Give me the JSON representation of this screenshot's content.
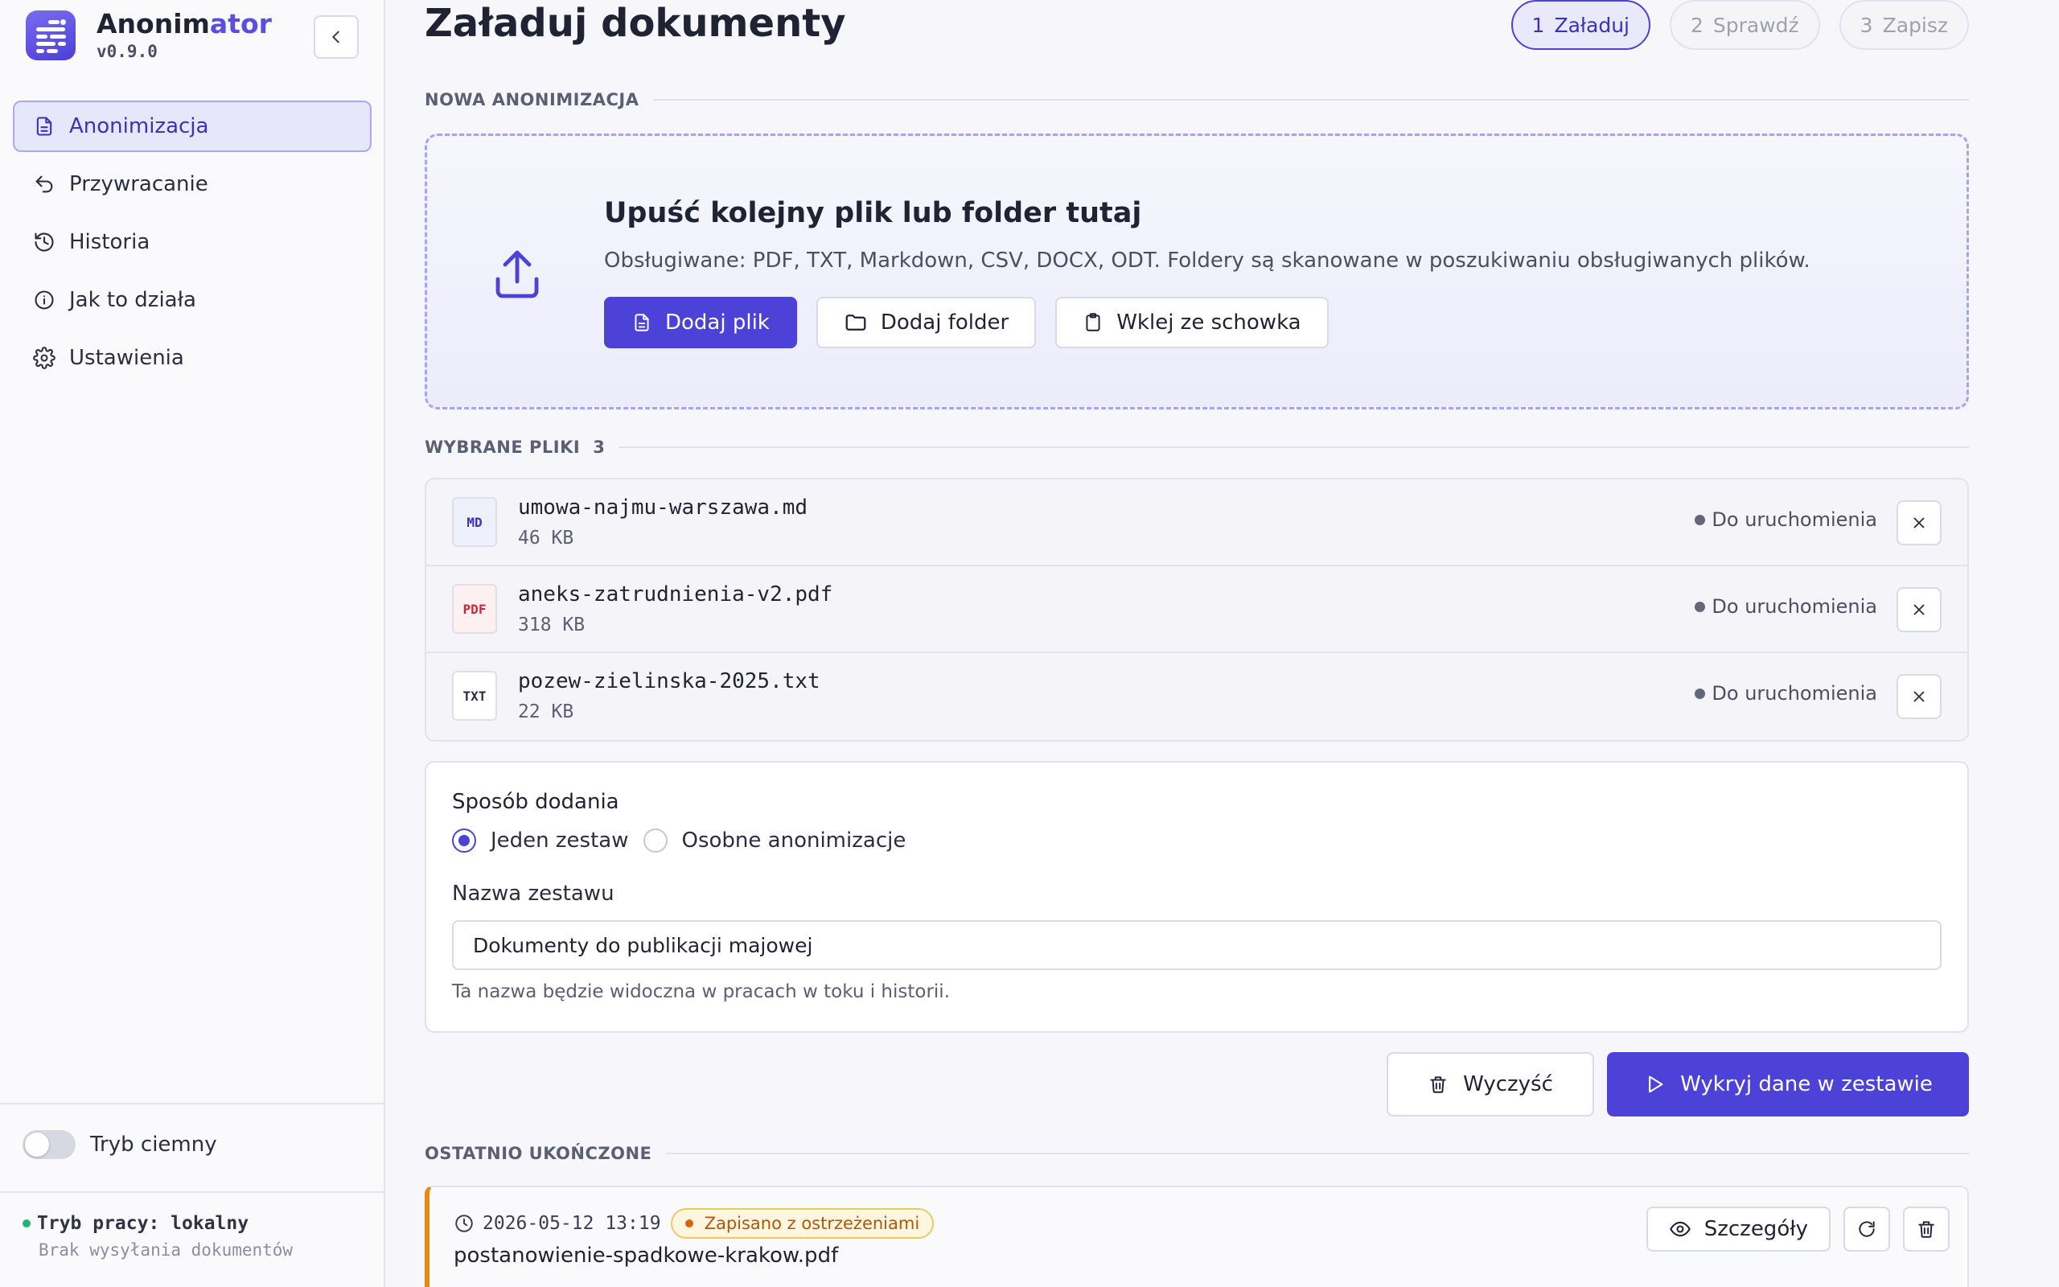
{
  "app": {
    "name_prefix": "Anonim",
    "name_accent": "ator",
    "version": "v0.9.0"
  },
  "sidebar": {
    "items": [
      {
        "label": "Anonimizacja",
        "icon": "document-icon",
        "active": true
      },
      {
        "label": "Przywracanie",
        "icon": "undo-icon"
      },
      {
        "label": "Historia",
        "icon": "history-icon"
      },
      {
        "label": "Jak to działa",
        "icon": "info-icon"
      },
      {
        "label": "Ustawienia",
        "icon": "gear-icon"
      }
    ],
    "theme_label": "Tryb ciemny",
    "theme_on": false,
    "mode_label": "Tryb pracy: lokalny",
    "mode_sub": "Brak wysyłania dokumentów"
  },
  "page": {
    "title": "Załaduj dokumenty"
  },
  "steps": [
    {
      "n": "1",
      "label": "Załaduj",
      "active": true
    },
    {
      "n": "2",
      "label": "Sprawdź"
    },
    {
      "n": "3",
      "label": "Zapisz"
    }
  ],
  "upload": {
    "section": "NOWA ANONIMIZACJA",
    "title": "Upuść kolejny plik lub folder tutaj",
    "subtitle": "Obsługiwane: PDF, TXT, Markdown, CSV, DOCX, ODT. Foldery są skanowane w poszukiwaniu obsługiwanych plików.",
    "add_file": "Dodaj plik",
    "add_folder": "Dodaj folder",
    "paste": "Wklej ze schowka"
  },
  "files": {
    "section": "WYBRANE PLIKI",
    "count": "3",
    "items": [
      {
        "type": "MD",
        "type_color": "#3b32b8",
        "name": "umowa-najmu-warszawa.md",
        "size": "46 KB",
        "status": "Do uruchomienia"
      },
      {
        "type": "PDF",
        "type_color": "#c52a3d",
        "name": "aneks-zatrudnienia-v2.pdf",
        "size": "318 KB",
        "status": "Do uruchomienia"
      },
      {
        "type": "TXT",
        "type_color": "#2a2e3f",
        "name": "pozew-zielinska-2025.txt",
        "size": "22 KB",
        "status": "Do uruchomienia"
      }
    ]
  },
  "options": {
    "mode_title": "Sposób dodania",
    "mode_one": "Jeden zestaw",
    "mode_separate": "Osobne anonimizacje",
    "selected": "Jeden zestaw",
    "name_label": "Nazwa zestawu",
    "name_value": "Dokumenty do publikacji majowej",
    "hint": "Ta nazwa będzie widoczna w pracach w toku i historii."
  },
  "actions": {
    "clear": "Wyczyść",
    "run": "Wykryj dane w zestawie"
  },
  "recent": {
    "section": "OSTATNIO UKOŃCZONE",
    "timestamp": "2026-05-12 13:19",
    "badge": "Zapisano z ostrzeżeniami",
    "file": "postanowienie-spadkowe-krakow.pdf",
    "details": "Szczegóły"
  },
  "colors": {
    "accent": "#4c42d8",
    "warning": "#e58a12",
    "ok": "#21b573"
  }
}
